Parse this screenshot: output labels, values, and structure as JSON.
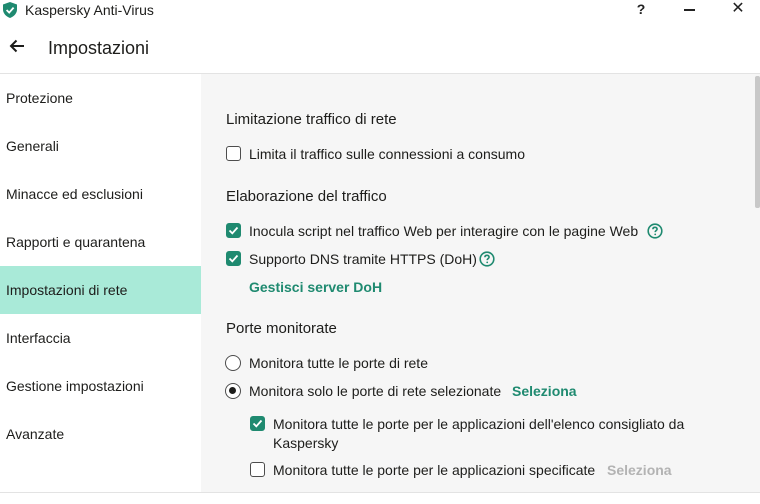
{
  "window": {
    "title": "Kaspersky Anti-Virus",
    "help": "?",
    "minimize": "—",
    "close": "✕",
    "logo_icon": "kaspersky-shield-icon",
    "accent": "#1f8a70"
  },
  "header": {
    "back_icon": "arrow-left-icon",
    "title": "Impostazioni"
  },
  "sidebar": {
    "items": [
      {
        "label": "Protezione"
      },
      {
        "label": "Generali"
      },
      {
        "label": "Minacce ed esclusioni"
      },
      {
        "label": "Rapporti e quarantena"
      },
      {
        "label": "Impostazioni di rete",
        "active": true
      },
      {
        "label": "Interfaccia"
      },
      {
        "label": "Gestione impostazioni"
      },
      {
        "label": "Avanzate"
      }
    ],
    "active_color": "#a9ead8"
  },
  "sections": {
    "traffic_limit": {
      "title": "Limitazione traffico di rete",
      "limit_metered": {
        "label": "Limita il traffico sulle connessioni a consumo",
        "checked": false
      }
    },
    "traffic_processing": {
      "title": "Elaborazione del traffico",
      "inject_script": {
        "label": "Inocula script nel traffico Web per interagire con le pagine Web",
        "checked": true
      },
      "doh": {
        "label": "Supporto DNS tramite HTTPS (DoH)",
        "checked": true
      },
      "manage_doh": "Gestisci server DoH"
    },
    "monitored_ports": {
      "title": "Porte monitorate",
      "all_ports": {
        "label": "Monitora tutte le porte di rete",
        "selected": false
      },
      "selected_ports": {
        "label": "Monitora solo le porte di rete selezionate",
        "selected": true,
        "link": "Seleziona"
      },
      "recommended_apps": {
        "label_line1": "Monitora tutte le porte per le applicazioni dell'elenco consigliato da",
        "label_line2": "Kaspersky",
        "checked": true
      },
      "specified_apps": {
        "label": "Monitora tutte le porte per le applicazioni specificate",
        "checked": false,
        "link": "Seleziona"
      }
    }
  }
}
